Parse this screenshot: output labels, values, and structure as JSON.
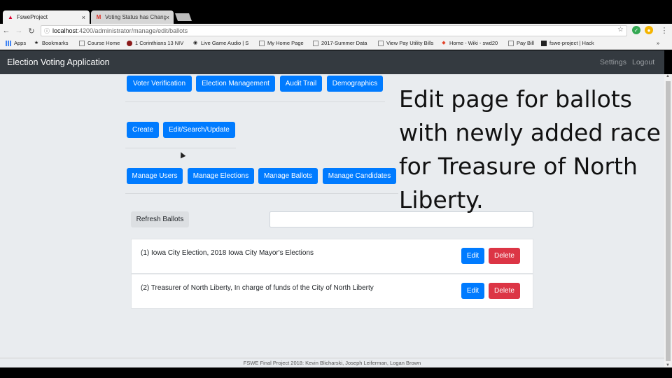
{
  "browser": {
    "tabs": [
      {
        "title": "FsweProject",
        "close": "×",
        "icon": "angular-icon"
      },
      {
        "title": "Voting Status has Chang",
        "close": "×",
        "icon": "gmail-icon"
      }
    ],
    "nav": {
      "back": "←",
      "forward": "→",
      "reload": "↻"
    },
    "url": {
      "host": "localhost",
      "path": ":4200/administrator/manage/edit/ballots"
    },
    "star": "☆",
    "menu": "⋮",
    "bookmarks_more": "»",
    "bookmarks": [
      {
        "label": "Apps",
        "icon": "apps-icon"
      },
      {
        "label": "Bookmarks",
        "icon": "star-icon"
      },
      {
        "label": "Course Home",
        "icon": "page-icon"
      },
      {
        "label": "1 Corinthians 13 NIV",
        "icon": "bible-icon"
      },
      {
        "label": "Live Game Audio | S",
        "icon": "audio-icon"
      },
      {
        "label": "My Home Page",
        "icon": "page-icon"
      },
      {
        "label": "2017-Summer Data",
        "icon": "page-icon"
      },
      {
        "label": "View Pay Utility Bills",
        "icon": "page-icon"
      },
      {
        "label": "Home - Wiki - swd20",
        "icon": "gitlab-icon"
      },
      {
        "label": "Pay Bill",
        "icon": "page-icon"
      },
      {
        "label": "fswe-project | Hack",
        "icon": "hackathon-icon"
      }
    ]
  },
  "app": {
    "brand": "Election Voting Application",
    "nav_links": [
      "Settings",
      "Logout"
    ],
    "section_buttons": [
      "Voter Verification",
      "Election Management",
      "Audit Trail",
      "Demographics"
    ],
    "action_buttons": [
      "Create",
      "Edit/Search/Update"
    ],
    "manage_buttons": [
      "Manage Users",
      "Manage Elections",
      "Manage Ballots",
      "Manage Candidates"
    ],
    "refresh_label": "Refresh Ballots",
    "search_value": "",
    "ballots": [
      {
        "text": "(1) Iowa City Election, 2018 Iowa City Mayor's Elections",
        "edit": "Edit",
        "delete": "Delete"
      },
      {
        "text": "(2) Treasurer of North Liberty, In charge of funds of the City of North Liberty",
        "edit": "Edit",
        "delete": "Delete"
      }
    ],
    "footer": "FSWE Final Project 2018: Kevin Blicharski, Joseph Leiferman, Logan Brown"
  },
  "annotation": {
    "lines": [
      "Edit page for ballots",
      "with newly added race",
      "for Treasure of North",
      "Liberty."
    ]
  },
  "colors": {
    "primary": "#007bff",
    "danger": "#dc3545",
    "navbar": "#343a40",
    "background": "#e9ecef"
  }
}
